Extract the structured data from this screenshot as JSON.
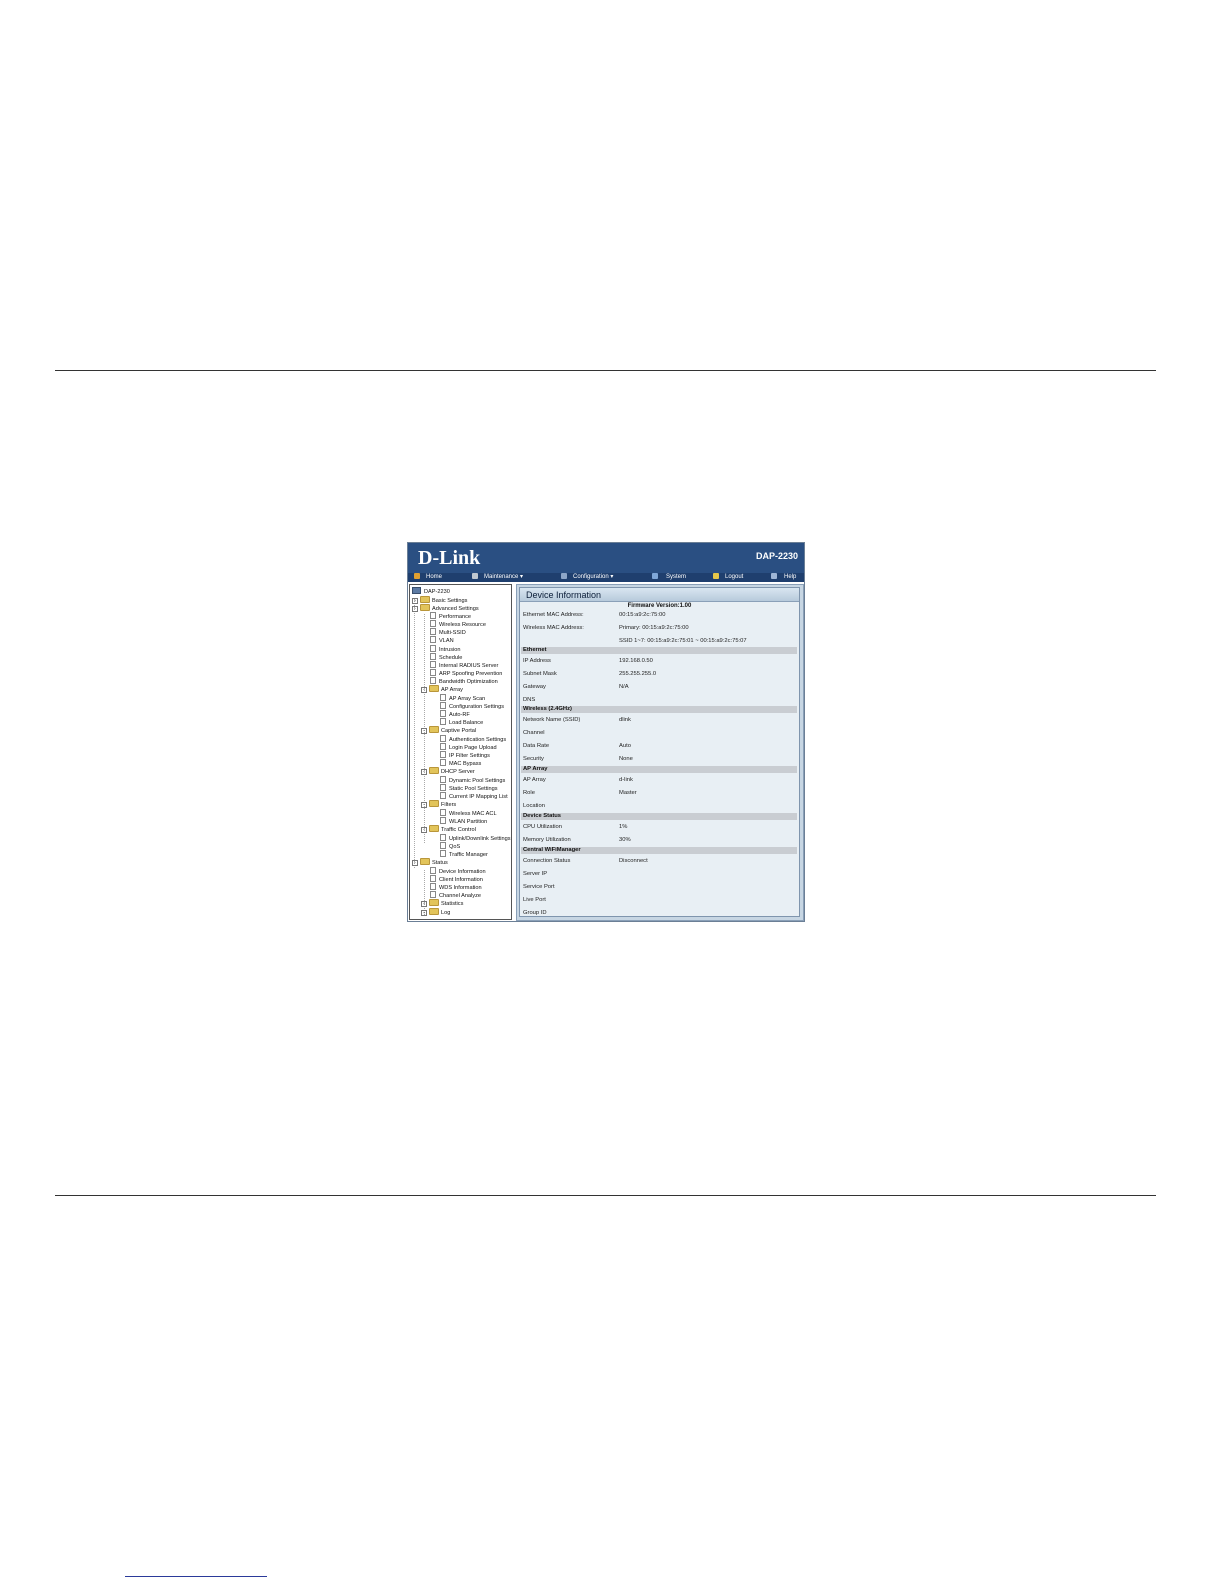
{
  "banner": {
    "logo": "D-Link",
    "model": "DAP-2230"
  },
  "menu": [
    {
      "label": "Home",
      "icon": "home-icon",
      "color": "#e0a030"
    },
    {
      "label": "Maintenance ▾",
      "icon": "tools-icon",
      "color": "#c0c8d0"
    },
    {
      "label": "Configuration ▾",
      "icon": "floppy-icon",
      "color": "#8da6c8"
    },
    {
      "label": "System",
      "icon": "system-icon",
      "color": "#7fa7d8"
    },
    {
      "label": "Logout",
      "icon": "logout-icon",
      "color": "#e6c84a"
    },
    {
      "label": "Help",
      "icon": "help-icon",
      "color": "#9fb6d6"
    }
  ],
  "tree": {
    "root": "DAP-2230",
    "basic": "Basic Settings",
    "advanced": "Advanced Settings",
    "advanced_items": [
      "Performance",
      "Wireless Resource",
      "Multi-SSID",
      "VLAN",
      "Intrusion",
      "Schedule",
      "Internal RADIUS Server",
      "ARP Spoofing Prevention",
      "Bandwidth Optimization"
    ],
    "ap_array": "AP Array",
    "ap_array_items": [
      "AP Array Scan",
      "Configuration Settings",
      "Auto-RF",
      "Load Balance"
    ],
    "captive": "Captive Portal",
    "captive_items": [
      "Authentication Settings",
      "Login Page Upload",
      "IP Filter Settings",
      "MAC Bypass"
    ],
    "dhcp": "DHCP Server",
    "dhcp_items": [
      "Dynamic Pool Settings",
      "Static Pool Settings",
      "Current IP Mapping List"
    ],
    "filters": "Filters",
    "filters_items": [
      "Wireless MAC ACL",
      "WLAN Partition"
    ],
    "traffic": "Traffic Control",
    "traffic_items": [
      "Uplink/Downlink Settings",
      "QoS",
      "Traffic Manager"
    ],
    "status": "Status",
    "status_items": [
      "Device Information",
      "Client Information",
      "WDS Information",
      "Channel Analyze"
    ],
    "statistics": "Statistics",
    "log": "Log"
  },
  "device_info": {
    "title": "Device Information",
    "firmware": "Firmware Version:1.00",
    "eth_mac_label": "Ethernet MAC Address:",
    "eth_mac": "00:15:a9:2c:75:00",
    "wl_mac_label": "Wireless MAC Address:",
    "wl_mac_primary": "Primary: 00:15:a9:2c:75:00",
    "wl_mac_ssid": "SSID 1~7: 00:15:a9:2c:75:01 ~ 00:15:a9:2c:75:07",
    "sec_ethernet": "Ethernet",
    "ip_label": "IP Address",
    "ip": "192.168.0.50",
    "mask_label": "Subnet Mask",
    "mask": "255.255.255.0",
    "gw_label": "Gateway",
    "gw": "N/A",
    "dns_label": "DNS",
    "dns": "",
    "sec_wireless": "Wireless (2.4GHz)",
    "ssid_label": "Network Name (SSID)",
    "ssid": "dlink",
    "channel_label": "Channel",
    "channel": "",
    "rate_label": "Data Rate",
    "rate": "Auto",
    "security_label": "Security",
    "security": "None",
    "sec_aparray": "AP Array",
    "aparray_label": "AP Array",
    "aparray": "d-link",
    "role_label": "Role",
    "role": "Master",
    "location_label": "Location",
    "location": "",
    "sec_status": "Device Status",
    "cpu_label": "CPU Utilization",
    "cpu": "1%",
    "mem_label": "Memory Utilization",
    "mem": "30%",
    "sec_cwm": "Central WiFiManager",
    "conn_label": "Connection Status",
    "conn": "Disconnect",
    "server_ip_label": "Server IP",
    "server_ip": "",
    "service_port_label": "Service Port",
    "service_port": "",
    "live_port_label": "Live Port",
    "live_port": "",
    "group_id_label": "Group ID",
    "group_id": ""
  }
}
